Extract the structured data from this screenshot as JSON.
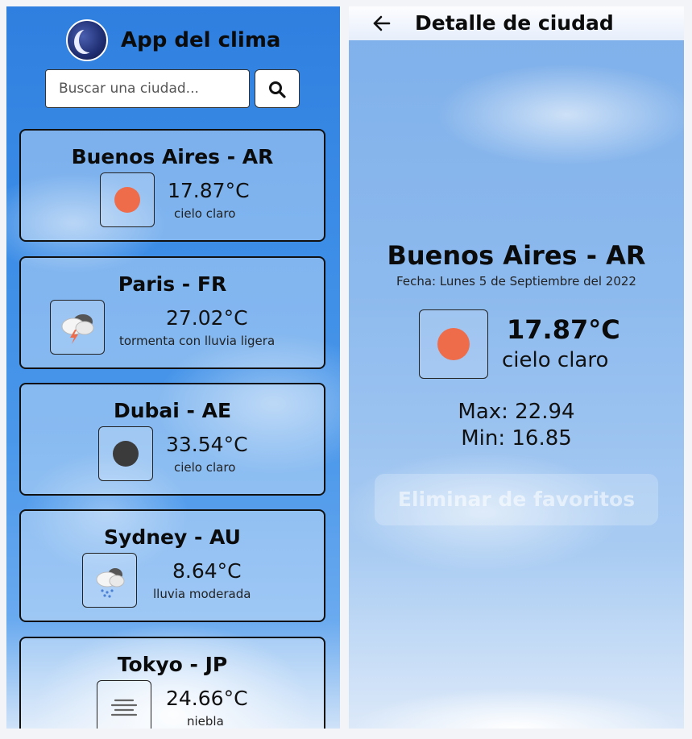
{
  "list_view": {
    "app_title": "App del clima",
    "search": {
      "placeholder": "Buscar una ciudad..."
    },
    "cards": [
      {
        "city": "Buenos Aires - AR",
        "temp": "17.87°C",
        "description": "cielo claro",
        "icon": "clear-sun-icon",
        "icon_color": "#ef6c4b"
      },
      {
        "city": "Paris - FR",
        "temp": "27.02°C",
        "description": "tormenta con lluvia ligera",
        "icon": "thunderstorm-icon"
      },
      {
        "city": "Dubai - AE",
        "temp": "33.54°C",
        "description": "cielo claro",
        "icon": "clear-night-icon",
        "icon_color": "#3b3b3b"
      },
      {
        "city": "Sydney - AU",
        "temp": "8.64°C",
        "description": "lluvia moderada",
        "icon": "rain-icon"
      },
      {
        "city": "Tokyo - JP",
        "temp": "24.66°C",
        "description": "niebla",
        "icon": "mist-icon"
      }
    ]
  },
  "detail_view": {
    "title": "Detalle de ciudad",
    "city": "Buenos Aires - AR",
    "date": "Fecha: Lunes 5 de Septiembre del 2022",
    "temp": "17.87°C",
    "description": "cielo claro",
    "max": "Max: 22.94",
    "min": "Min: 16.85",
    "remove_button": "Eliminar de favoritos",
    "icon": "clear-sun-icon",
    "icon_color": "#ef6c4b"
  }
}
